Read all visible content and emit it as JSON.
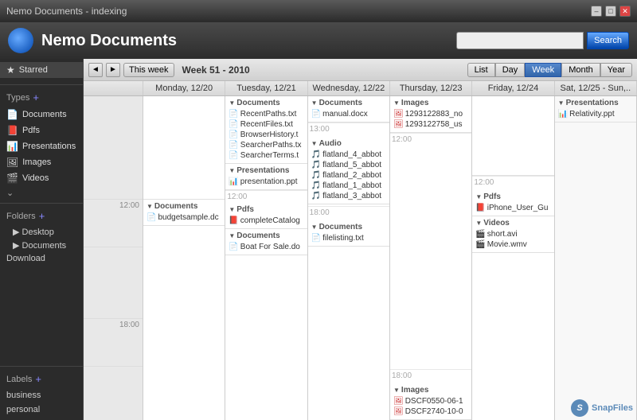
{
  "titlebar": {
    "title": "Nemo Documents - indexing",
    "min_label": "–",
    "max_label": "□",
    "close_label": "✕"
  },
  "header": {
    "app_title": "Nemo Documents",
    "search_placeholder": "",
    "search_btn_label": "Search"
  },
  "toolbar": {
    "nav_prev": "◄",
    "nav_next": "►",
    "this_week_label": "This week",
    "week_label": "Week 51 - 2010",
    "views": [
      "List",
      "Day",
      "Week",
      "Month",
      "Year"
    ],
    "active_view": "Week"
  },
  "sidebar": {
    "starred_label": "Starred",
    "types_label": "Types",
    "type_items": [
      {
        "label": "Documents",
        "icon": "📄"
      },
      {
        "label": "Pdfs",
        "icon": "📕"
      },
      {
        "label": "Presentations",
        "icon": "📊"
      },
      {
        "label": "Images",
        "icon": "🖼"
      },
      {
        "label": "Videos",
        "icon": "🎬"
      }
    ],
    "folders_label": "Folders",
    "folder_items": [
      "Desktop",
      "Documents",
      "Download"
    ],
    "labels_label": "Labels",
    "label_items": [
      "business",
      "personal"
    ]
  },
  "calendar": {
    "days": [
      {
        "label": "Monday, 12/20"
      },
      {
        "label": "Tuesday, 12/21"
      },
      {
        "label": "Wednesday, 12/22"
      },
      {
        "label": "Thursday, 12/23"
      },
      {
        "label": "Friday, 12/24"
      },
      {
        "label": "Sat, 12/25 - Sun,.."
      }
    ],
    "time_slots": [
      "12:00",
      "12:00",
      "12:00",
      "12:00",
      "12:00",
      "12:00",
      "18:00",
      "18:00",
      "18:00",
      "18:00",
      "18:00",
      "18:00"
    ],
    "monday": {
      "sections_top": [],
      "sections_mid": [
        {
          "category": "Documents",
          "files": [
            "budgetsample.dc"
          ]
        }
      ]
    },
    "tuesday": {
      "sections_top": [
        {
          "category": "Documents",
          "files": [
            "RecentPaths.txt",
            "RecentFiles.txt",
            "BrowserHistory.t",
            "SearcherPaths.tx",
            "SearcherTerms.t"
          ]
        },
        {
          "category": "Presentations",
          "files": [
            "presentation.ppt"
          ]
        }
      ],
      "sections_mid": [
        {
          "category": "Pdfs",
          "files": [
            "completeCatalog"
          ]
        },
        {
          "category": "Documents",
          "files": [
            "Boat For Sale.do"
          ]
        }
      ]
    },
    "wednesday": {
      "sections_top": [
        {
          "category": "Documents",
          "files": [
            "manual.docx"
          ]
        }
      ],
      "sections_mid": [
        {
          "category": "Audio",
          "files": [
            "flatland_4_abbot",
            "flatland_5_abbot",
            "flatland_2_abbot",
            "flatland_1_abbot",
            "flatland_3_abbot"
          ]
        }
      ],
      "sections_bot": [
        {
          "category": "Documents",
          "files": [
            "filelisting.txt"
          ]
        }
      ]
    },
    "thursday": {
      "sections_top": [
        {
          "category": "Images",
          "files": [
            "1293122883_no",
            "1293122758_us"
          ]
        }
      ],
      "sections_bot": [
        {
          "category": "Images",
          "files": [
            "DSCF0550-06-1",
            "DSCF2740-10-0"
          ]
        }
      ]
    },
    "friday": {
      "sections_mid": [
        {
          "category": "Pdfs",
          "files": [
            "iPhone_User_Gu"
          ]
        },
        {
          "category": "Videos",
          "files": [
            "short.avi",
            "Movie.wmv"
          ]
        }
      ]
    },
    "weekend": {
      "sections_top": [
        {
          "category": "Presentations",
          "files": [
            "Relativity.ppt"
          ]
        }
      ]
    }
  },
  "watermark": {
    "logo": "S",
    "text": "SnapFiles"
  }
}
